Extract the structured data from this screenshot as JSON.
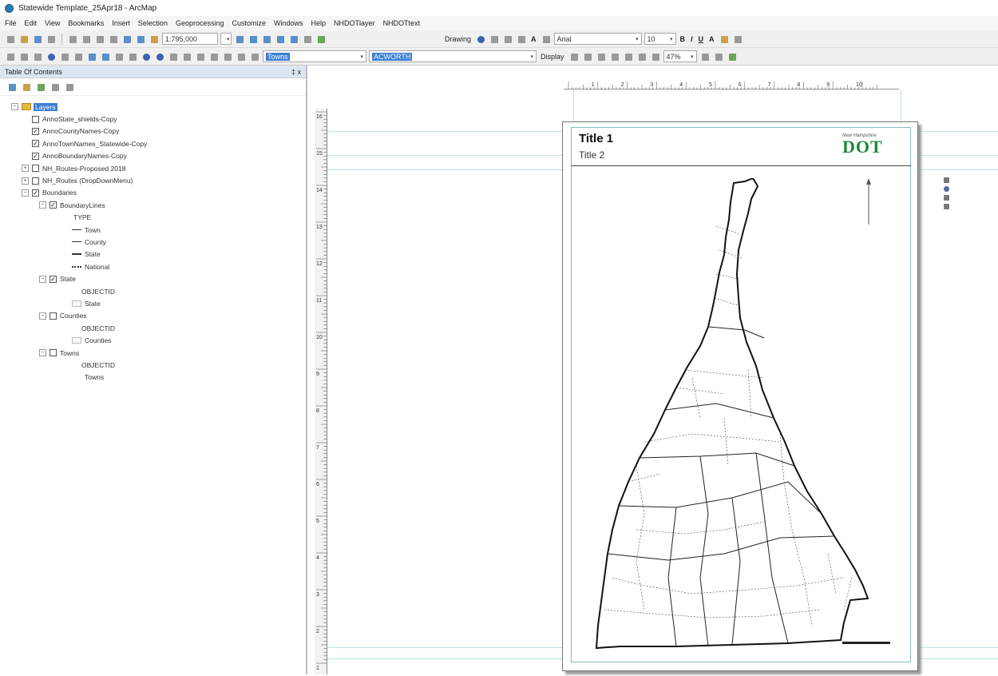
{
  "window": {
    "title": "Statewide Template_25Apr18 - ArcMap"
  },
  "menu": [
    "File",
    "Edit",
    "View",
    "Bookmarks",
    "Insert",
    "Selection",
    "Geoprocessing",
    "Customize",
    "Windows",
    "Help",
    "NHDOTlayer",
    "NHDOTtext"
  ],
  "toolbar1": {
    "scale": "1:795,000",
    "drawing_label": "Drawing",
    "font": "Arial",
    "font_size": "10"
  },
  "toolbar2": {
    "layer_combo": "Towns",
    "town_combo": "ACWORTH",
    "display_label": "Display",
    "zoom": "47%"
  },
  "toc": {
    "title": "Table Of Contents",
    "pin": "‡ x",
    "root": "Layers",
    "items": [
      {
        "label": "AnnoState_shields-Copy",
        "checked": false
      },
      {
        "label": "AnnoCountyNames-Copy",
        "checked": true
      },
      {
        "label": "AnnoTownNames_Statewide-Copy",
        "checked": true
      },
      {
        "label": "AnnoBoundaryNames-Copy",
        "checked": true
      },
      {
        "label": "NH_Routes-Proposed 2018",
        "checked": false
      },
      {
        "label": "NH_Routes (DropDownMenu)",
        "checked": false
      },
      {
        "label": "Boundaries",
        "checked": true
      },
      {
        "label": "BoundaryLines",
        "checked": true
      },
      {
        "label": "TYPE"
      },
      {
        "label": "Town"
      },
      {
        "label": "County"
      },
      {
        "label": "State"
      },
      {
        "label": "National"
      },
      {
        "label": "State",
        "checked": true
      },
      {
        "label": "OBJECTID"
      },
      {
        "label": "State"
      },
      {
        "label": "Counties",
        "checked": false
      },
      {
        "label": "OBJECTID"
      },
      {
        "label": "Counties"
      },
      {
        "label": "Towns",
        "checked": false
      },
      {
        "label": "OBJECTID"
      },
      {
        "label": "Towns"
      }
    ]
  },
  "layout": {
    "title1": "Title 1",
    "title2": "Title 2",
    "logo_small": "New Hampshire",
    "logo_big": "DOT",
    "ruler_numbers": [
      "1",
      "2",
      "3",
      "4",
      "5",
      "6",
      "7",
      "8",
      "9",
      "10"
    ],
    "left_ruler_numbers": [
      "16",
      "15",
      "14",
      "13",
      "12",
      "11",
      "10",
      "9",
      "8",
      "7",
      "6",
      "5",
      "4",
      "3",
      "2",
      "1"
    ]
  }
}
